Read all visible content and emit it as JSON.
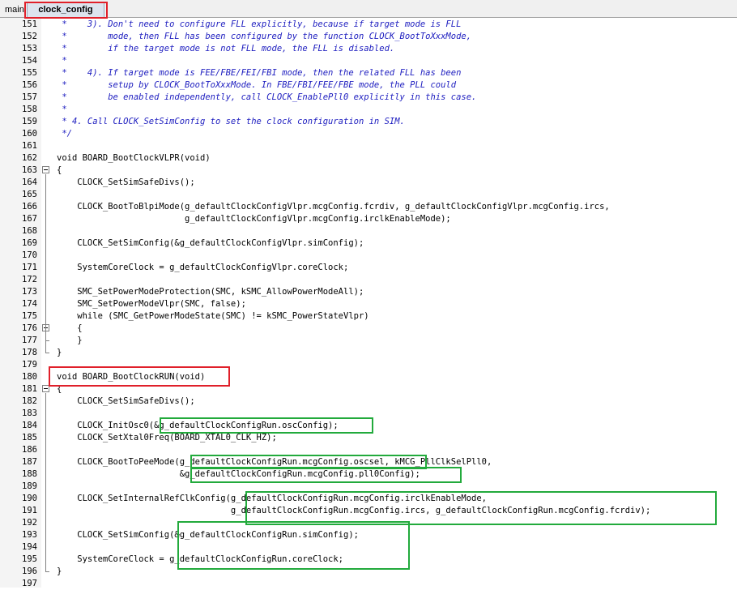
{
  "tabs": [
    {
      "label": "main"
    },
    {
      "label": "clock_config"
    }
  ],
  "lines": [
    {
      "n": "151",
      "t": " *    3). Don't need to configure FLL explicitly, because if target mode is FLL",
      "c": true
    },
    {
      "n": "152",
      "t": " *        mode, then FLL has been configured by the function CLOCK_BootToXxxMode,",
      "c": true
    },
    {
      "n": "153",
      "t": " *        if the target mode is not FLL mode, the FLL is disabled.",
      "c": true
    },
    {
      "n": "154",
      "t": " *",
      "c": true
    },
    {
      "n": "155",
      "t": " *    4). If target mode is FEE/FBE/FEI/FBI mode, then the related FLL has been",
      "c": true
    },
    {
      "n": "156",
      "t": " *        setup by CLOCK_BootToXxxMode. In FBE/FBI/FEE/FBE mode, the PLL could",
      "c": true
    },
    {
      "n": "157",
      "t": " *        be enabled independently, call CLOCK_EnablePll0 explicitly in this case.",
      "c": true
    },
    {
      "n": "158",
      "t": " *",
      "c": true
    },
    {
      "n": "159",
      "t": " * 4. Call CLOCK_SetSimConfig to set the clock configuration in SIM.",
      "c": true
    },
    {
      "n": "160",
      "t": " */",
      "c": true
    },
    {
      "n": "161",
      "t": "",
      "c": false
    },
    {
      "n": "162",
      "t": "void BOARD_BootClockVLPR(void)",
      "c": false
    },
    {
      "n": "163",
      "t": "{",
      "c": false
    },
    {
      "n": "164",
      "t": "    CLOCK_SetSimSafeDivs();",
      "c": false
    },
    {
      "n": "165",
      "t": "",
      "c": false
    },
    {
      "n": "166",
      "t": "    CLOCK_BootToBlpiMode(g_defaultClockConfigVlpr.mcgConfig.fcrdiv, g_defaultClockConfigVlpr.mcgConfig.ircs,",
      "c": false
    },
    {
      "n": "167",
      "t": "                         g_defaultClockConfigVlpr.mcgConfig.irclkEnableMode);",
      "c": false
    },
    {
      "n": "168",
      "t": "",
      "c": false
    },
    {
      "n": "169",
      "t": "    CLOCK_SetSimConfig(&g_defaultClockConfigVlpr.simConfig);",
      "c": false
    },
    {
      "n": "170",
      "t": "",
      "c": false
    },
    {
      "n": "171",
      "t": "    SystemCoreClock = g_defaultClockConfigVlpr.coreClock;",
      "c": false
    },
    {
      "n": "172",
      "t": "",
      "c": false
    },
    {
      "n": "173",
      "t": "    SMC_SetPowerModeProtection(SMC, kSMC_AllowPowerModeAll);",
      "c": false
    },
    {
      "n": "174",
      "t": "    SMC_SetPowerModeVlpr(SMC, false);",
      "c": false
    },
    {
      "n": "175",
      "t": "    while (SMC_GetPowerModeState(SMC) != kSMC_PowerStateVlpr)",
      "c": false
    },
    {
      "n": "176",
      "t": "    {",
      "c": false
    },
    {
      "n": "177",
      "t": "    }",
      "c": false
    },
    {
      "n": "178",
      "t": "}",
      "c": false
    },
    {
      "n": "179",
      "t": "",
      "c": false
    },
    {
      "n": "180",
      "t": "void BOARD_BootClockRUN(void)",
      "c": false
    },
    {
      "n": "181",
      "t": "{",
      "c": false
    },
    {
      "n": "182",
      "t": "    CLOCK_SetSimSafeDivs();",
      "c": false
    },
    {
      "n": "183",
      "t": "",
      "c": false
    },
    {
      "n": "184",
      "t": "    CLOCK_InitOsc0(&g_defaultClockConfigRun.oscConfig);",
      "c": false
    },
    {
      "n": "185",
      "t": "    CLOCK_SetXtal0Freq(BOARD_XTAL0_CLK_HZ);",
      "c": false
    },
    {
      "n": "186",
      "t": "",
      "c": false
    },
    {
      "n": "187",
      "t": "    CLOCK_BootToPeeMode(g_defaultClockConfigRun.mcgConfig.oscsel, kMCG_PllClkSelPll0,",
      "c": false
    },
    {
      "n": "188",
      "t": "                        &g_defaultClockConfigRun.mcgConfig.pll0Config);",
      "c": false
    },
    {
      "n": "189",
      "t": "",
      "c": false
    },
    {
      "n": "190",
      "t": "    CLOCK_SetInternalRefClkConfig(g_defaultClockConfigRun.mcgConfig.irclkEnableMode,",
      "c": false
    },
    {
      "n": "191",
      "t": "                                  g_defaultClockConfigRun.mcgConfig.ircs, g_defaultClockConfigRun.mcgConfig.fcrdiv);",
      "c": false
    },
    {
      "n": "192",
      "t": "",
      "c": false
    },
    {
      "n": "193",
      "t": "    CLOCK_SetSimConfig(&g_defaultClockConfigRun.simConfig);",
      "c": false
    },
    {
      "n": "194",
      "t": "",
      "c": false
    },
    {
      "n": "195",
      "t": "    SystemCoreClock = g_defaultClockConfigRun.coreClock;",
      "c": false
    },
    {
      "n": "196",
      "t": "}",
      "c": false
    },
    {
      "n": "197",
      "t": "",
      "c": false
    }
  ],
  "colors": {
    "comment": "#2020c0",
    "highlight_red": "#e0202a",
    "highlight_green": "#22aa3c"
  }
}
